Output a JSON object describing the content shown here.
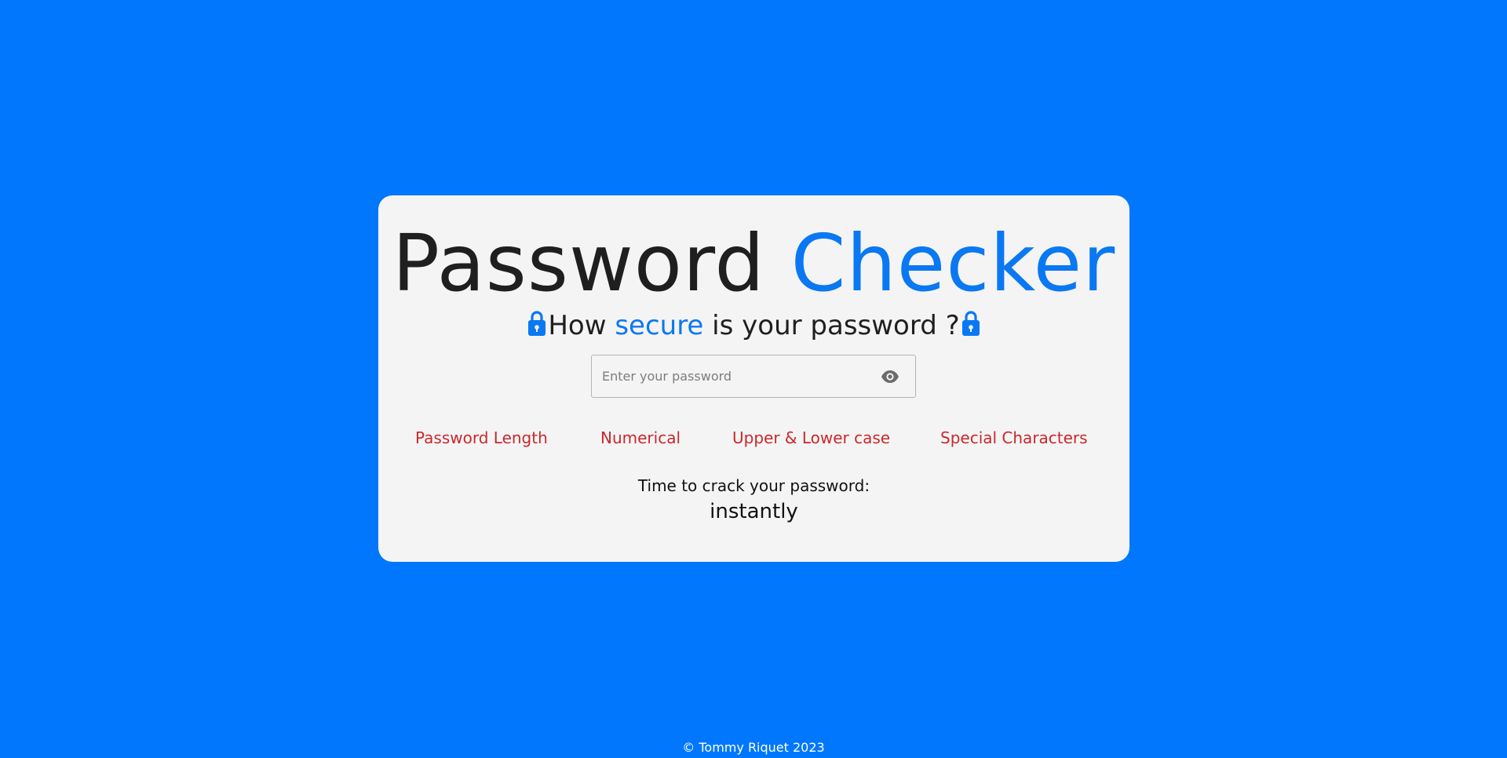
{
  "title": {
    "part1": "Password",
    "part2": "Checker"
  },
  "subtitle": {
    "before": "How",
    "accent": "secure",
    "after": "is your password ?"
  },
  "password_input": {
    "placeholder": "Enter your password",
    "value": ""
  },
  "criteria": [
    {
      "label": "Password Length"
    },
    {
      "label": "Numerical"
    },
    {
      "label": "Upper & Lower case"
    },
    {
      "label": "Special Characters"
    }
  ],
  "crack": {
    "label": "Time to crack your password:",
    "value": "instantly"
  },
  "footer": {
    "text": "© Tommy Riquet 2023"
  },
  "colors": {
    "background": "#0177fd",
    "card": "#f4f4f4",
    "accent": "#0a78f2",
    "criteria_unmet": "#c8282d"
  },
  "icons": {
    "left_lock": "lock-icon",
    "right_lock": "lock-icon",
    "toggle_visibility": "eye-icon"
  }
}
